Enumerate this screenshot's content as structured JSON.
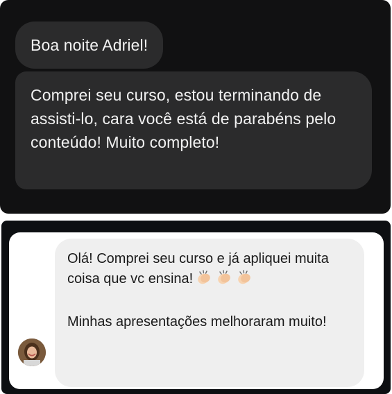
{
  "top_chat": {
    "message_1": "Boa noite Adriel!",
    "message_2": "Comprei seu curso, estou terminando de assisti-lo, cara você está de parabéns pelo conteúdo! Muito completo!"
  },
  "bottom_chat": {
    "paragraph_1": "Olá! Comprei seu curso e já apliquei muita coisa que vc ensina!",
    "emoji": [
      "clapping-hands-icon",
      "clapping-hands-icon",
      "clapping-hands-icon"
    ],
    "paragraph_2": "Minhas apresentações melhoraram muito!",
    "avatar": "user-avatar"
  },
  "colors": {
    "dark_background": "#111112",
    "dark_bubble": "#2b2b2c",
    "dark_text": "#f2f2f2",
    "light_bubble": "#efefef",
    "light_text": "#1a1a1a"
  }
}
